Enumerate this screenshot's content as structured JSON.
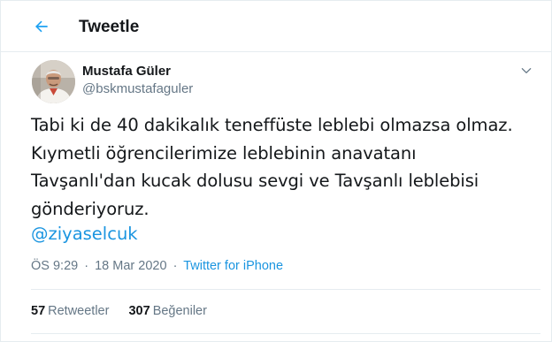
{
  "header": {
    "title": "Tweetle",
    "back_icon": "arrow-left-icon"
  },
  "author": {
    "name": "Mustafa Güler",
    "handle": "@bskmustafaguler"
  },
  "tweet": {
    "lines": [
      "Tabi ki de 40 dakikalık teneffüste leblebi olmazsa olmaz.",
      "Kıymetli öğrencilerimize leblebinin anavatanı",
      "Tavşanlı'dan kucak dolusu sevgi ve Tavşanlı leblebisi",
      "gönderiyoruz."
    ],
    "mention": "@ziyaselcuk",
    "time": "ÖS 9:29",
    "separator": "·",
    "date": "18 Mar 2020",
    "source": "Twitter for iPhone"
  },
  "stats": {
    "retweets_count": "57",
    "retweets_label": "Retweetler",
    "likes_count": "307",
    "likes_label": "Beğeniler"
  },
  "colors": {
    "accent": "#1b95e0",
    "text": "#14171a",
    "muted": "#657786",
    "border": "#e6ecf0"
  }
}
